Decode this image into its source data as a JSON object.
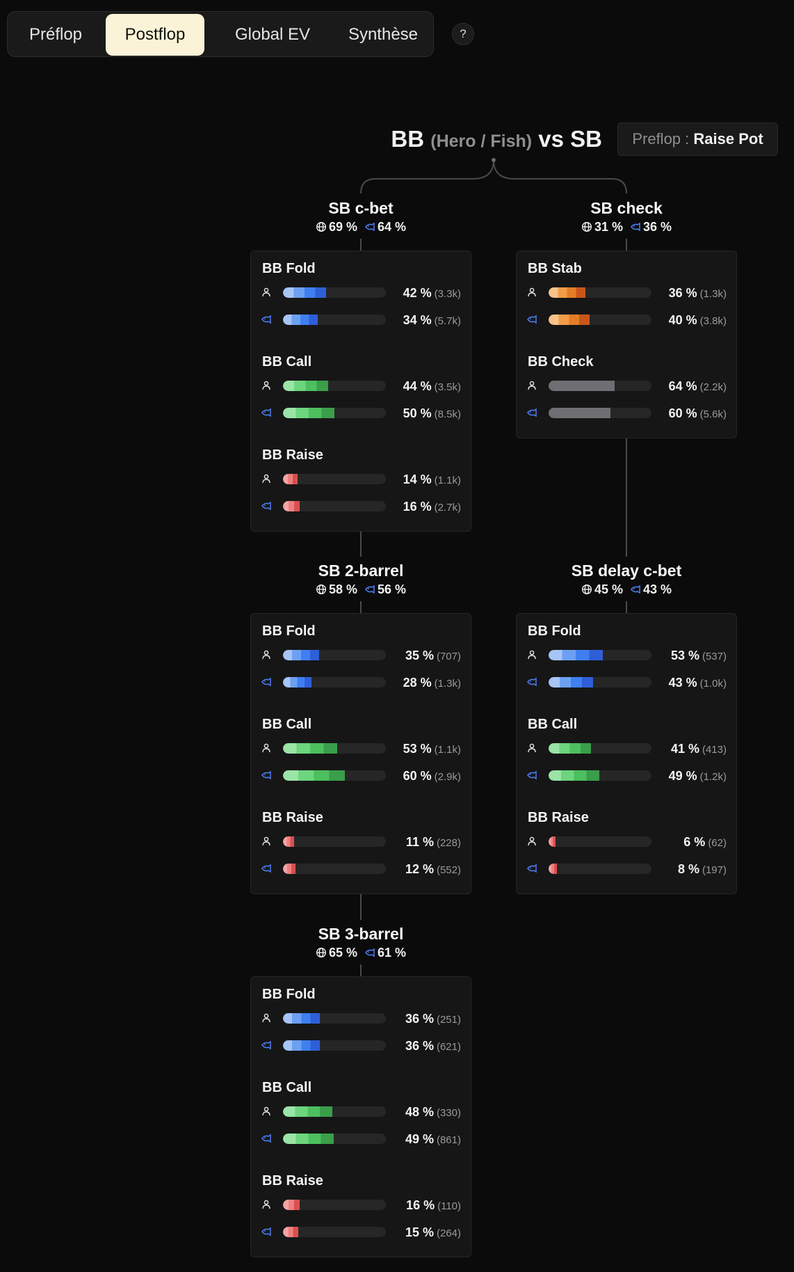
{
  "tabs": [
    "Préflop",
    "Postflop",
    "Global EV",
    "Synthèse"
  ],
  "active_tab": 1,
  "help_label": "?",
  "header": {
    "hero": "BB",
    "subtitle": "(Hero / Fish)",
    "vs": "vs SB",
    "preflop_label": "Preflop :",
    "preflop_value": "Raise Pot"
  },
  "colors": {
    "fold": [
      "#a6c4f6",
      "#6ca0f2",
      "#3f7ff0",
      "#2f5fd8"
    ],
    "call": [
      "#9ae4a6",
      "#6cd57e",
      "#4cbf5f",
      "#3a9e4b"
    ],
    "raise": [
      "#f4a4a4",
      "#ee7f7f",
      "#d85050"
    ],
    "stab": [
      "#f8c38a",
      "#f29c48",
      "#e47d28",
      "#c8561a"
    ],
    "check": [
      "#6f6f73"
    ]
  },
  "nodes": [
    {
      "title": "SB c-bet",
      "stat_global": "69 %",
      "stat_fish": "64 %",
      "groups": [
        {
          "label": "BB Fold",
          "type": "fold",
          "rows": [
            {
              "pct": 42,
              "pct_label": "42 %",
              "count": "(3.3k)"
            },
            {
              "pct": 34,
              "pct_label": "34 %",
              "count": "(5.7k)"
            }
          ]
        },
        {
          "label": "BB Call",
          "type": "call",
          "rows": [
            {
              "pct": 44,
              "pct_label": "44 %",
              "count": "(3.5k)"
            },
            {
              "pct": 50,
              "pct_label": "50 %",
              "count": "(8.5k)"
            }
          ]
        },
        {
          "label": "BB Raise",
          "type": "raise",
          "rows": [
            {
              "pct": 14,
              "pct_label": "14 %",
              "count": "(1.1k)"
            },
            {
              "pct": 16,
              "pct_label": "16 %",
              "count": "(2.7k)"
            }
          ]
        }
      ]
    },
    {
      "title": "SB check",
      "stat_global": "31 %",
      "stat_fish": "36 %",
      "groups": [
        {
          "label": "BB Stab",
          "type": "stab",
          "rows": [
            {
              "pct": 36,
              "pct_label": "36 %",
              "count": "(1.3k)"
            },
            {
              "pct": 40,
              "pct_label": "40 %",
              "count": "(3.8k)"
            }
          ]
        },
        {
          "label": "BB Check",
          "type": "check",
          "rows": [
            {
              "pct": 64,
              "pct_label": "64 %",
              "count": "(2.2k)"
            },
            {
              "pct": 60,
              "pct_label": "60 %",
              "count": "(5.6k)"
            }
          ]
        }
      ]
    },
    {
      "title": "SB 2-barrel",
      "stat_global": "58 %",
      "stat_fish": "56 %",
      "groups": [
        {
          "label": "BB Fold",
          "type": "fold",
          "rows": [
            {
              "pct": 35,
              "pct_label": "35 %",
              "count": "(707)"
            },
            {
              "pct": 28,
              "pct_label": "28 %",
              "count": "(1.3k)"
            }
          ]
        },
        {
          "label": "BB Call",
          "type": "call",
          "rows": [
            {
              "pct": 53,
              "pct_label": "53 %",
              "count": "(1.1k)"
            },
            {
              "pct": 60,
              "pct_label": "60 %",
              "count": "(2.9k)"
            }
          ]
        },
        {
          "label": "BB Raise",
          "type": "raise",
          "rows": [
            {
              "pct": 11,
              "pct_label": "11 %",
              "count": "(228)"
            },
            {
              "pct": 12,
              "pct_label": "12 %",
              "count": "(552)"
            }
          ]
        }
      ]
    },
    {
      "title": "SB delay c-bet",
      "stat_global": "45 %",
      "stat_fish": "43 %",
      "groups": [
        {
          "label": "BB Fold",
          "type": "fold",
          "rows": [
            {
              "pct": 53,
              "pct_label": "53 %",
              "count": "(537)"
            },
            {
              "pct": 43,
              "pct_label": "43 %",
              "count": "(1.0k)"
            }
          ]
        },
        {
          "label": "BB Call",
          "type": "call",
          "rows": [
            {
              "pct": 41,
              "pct_label": "41 %",
              "count": "(413)"
            },
            {
              "pct": 49,
              "pct_label": "49 %",
              "count": "(1.2k)"
            }
          ]
        },
        {
          "label": "BB Raise",
          "type": "raise",
          "rows": [
            {
              "pct": 6,
              "pct_label": "6 %",
              "count": "(62)"
            },
            {
              "pct": 8,
              "pct_label": "8 %",
              "count": "(197)"
            }
          ]
        }
      ]
    },
    {
      "title": "SB 3-barrel",
      "stat_global": "65 %",
      "stat_fish": "61 %",
      "groups": [
        {
          "label": "BB Fold",
          "type": "fold",
          "rows": [
            {
              "pct": 36,
              "pct_label": "36 %",
              "count": "(251)"
            },
            {
              "pct": 36,
              "pct_label": "36 %",
              "count": "(621)"
            }
          ]
        },
        {
          "label": "BB Call",
          "type": "call",
          "rows": [
            {
              "pct": 48,
              "pct_label": "48 %",
              "count": "(330)"
            },
            {
              "pct": 49,
              "pct_label": "49 %",
              "count": "(861)"
            }
          ]
        },
        {
          "label": "BB Raise",
          "type": "raise",
          "rows": [
            {
              "pct": 16,
              "pct_label": "16 %",
              "count": "(110)"
            },
            {
              "pct": 15,
              "pct_label": "15 %",
              "count": "(264)"
            }
          ]
        }
      ]
    }
  ]
}
